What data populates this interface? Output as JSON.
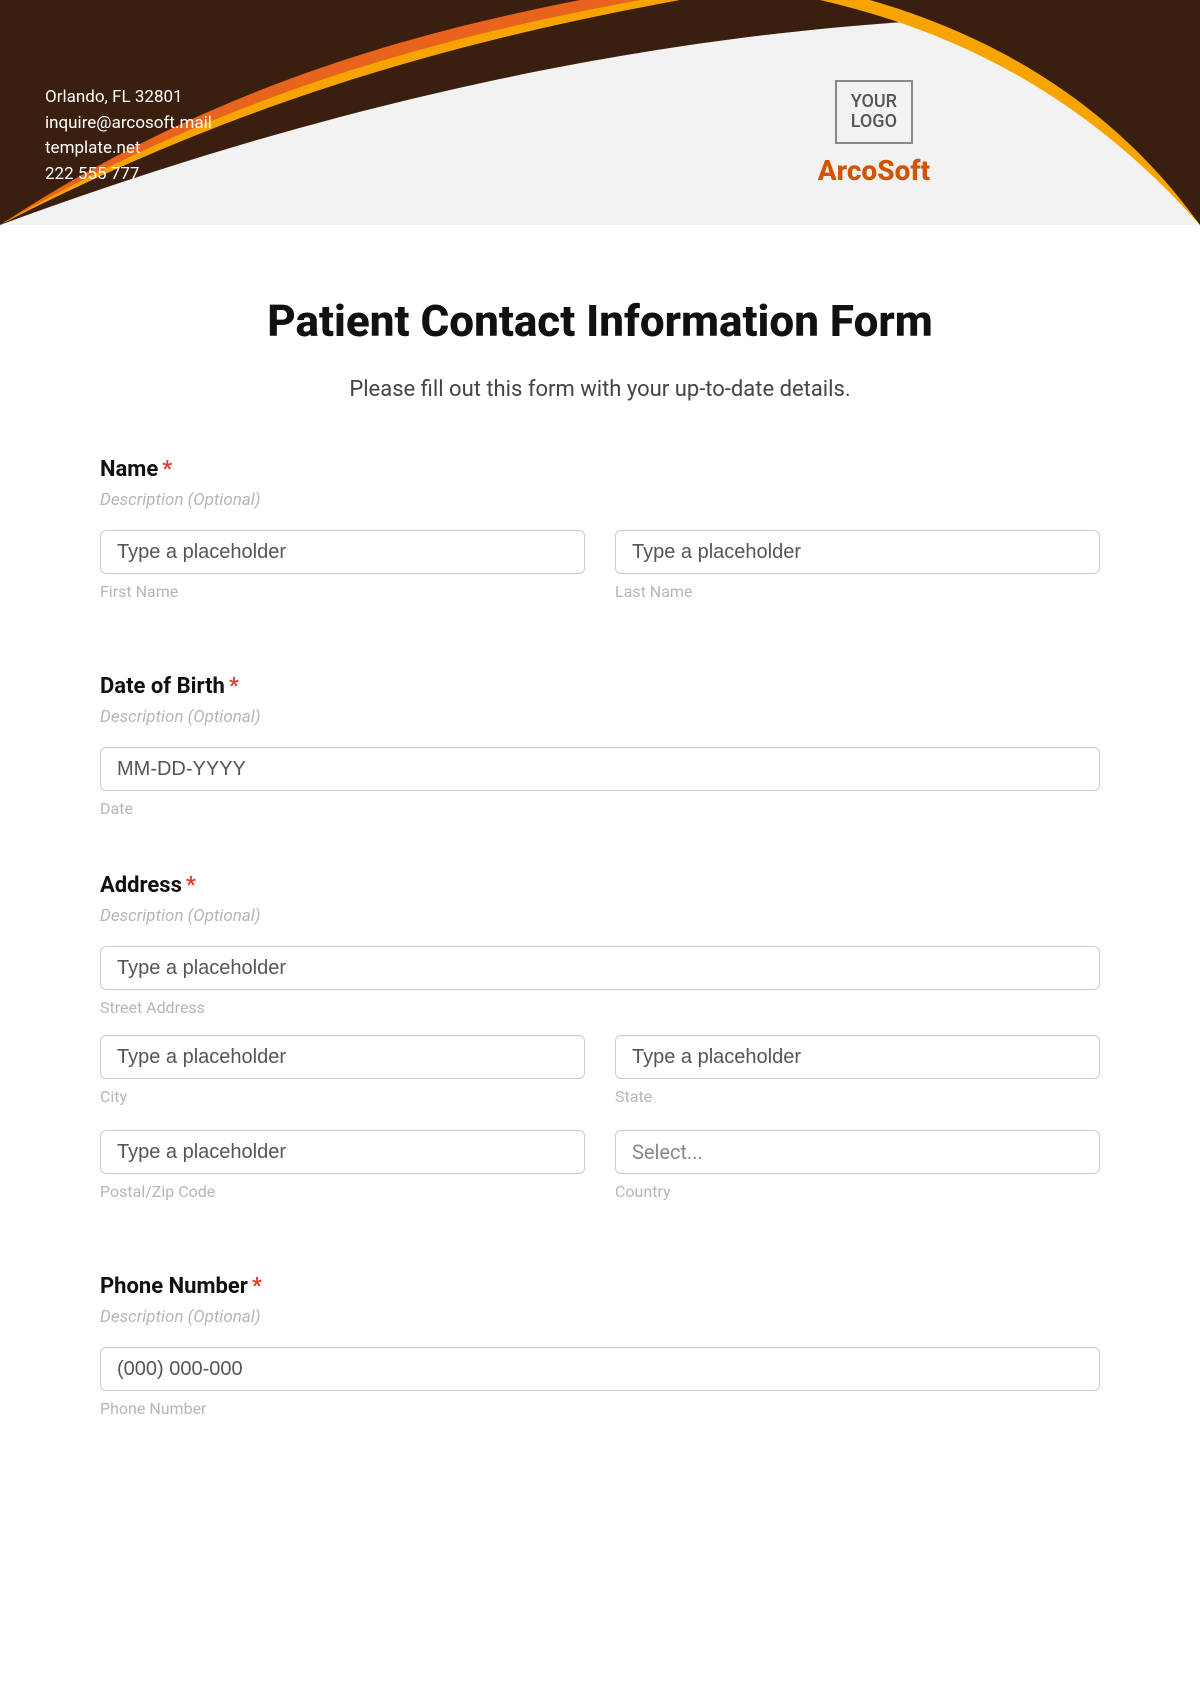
{
  "header": {
    "address": "Orlando, FL 32801",
    "email": "inquire@arcosoft.mail",
    "website": "template.net",
    "phone": "222 555 777",
    "logo_line1": "YOUR",
    "logo_line2": "LOGO",
    "brand": "ArcoSoft"
  },
  "form": {
    "title": "Patient Contact Information Form",
    "subtitle": "Please fill out this form with your up-to-date details.",
    "description_placeholder": "Description (Optional)",
    "generic_placeholder": "Type a placeholder",
    "sections": {
      "name": {
        "label": "Name",
        "first_sub": "First Name",
        "last_sub": "Last Name"
      },
      "dob": {
        "label": "Date of Birth",
        "placeholder": "MM-DD-YYYY",
        "sub": "Date"
      },
      "address": {
        "label": "Address",
        "street_sub": "Street Address",
        "city_sub": "City",
        "state_sub": "State",
        "postal_sub": "Postal/Zip Code",
        "country_sub": "Country",
        "country_placeholder": "Select..."
      },
      "phone": {
        "label": "Phone Number",
        "placeholder": "(000) 000-000",
        "sub": "Phone Number"
      }
    }
  }
}
